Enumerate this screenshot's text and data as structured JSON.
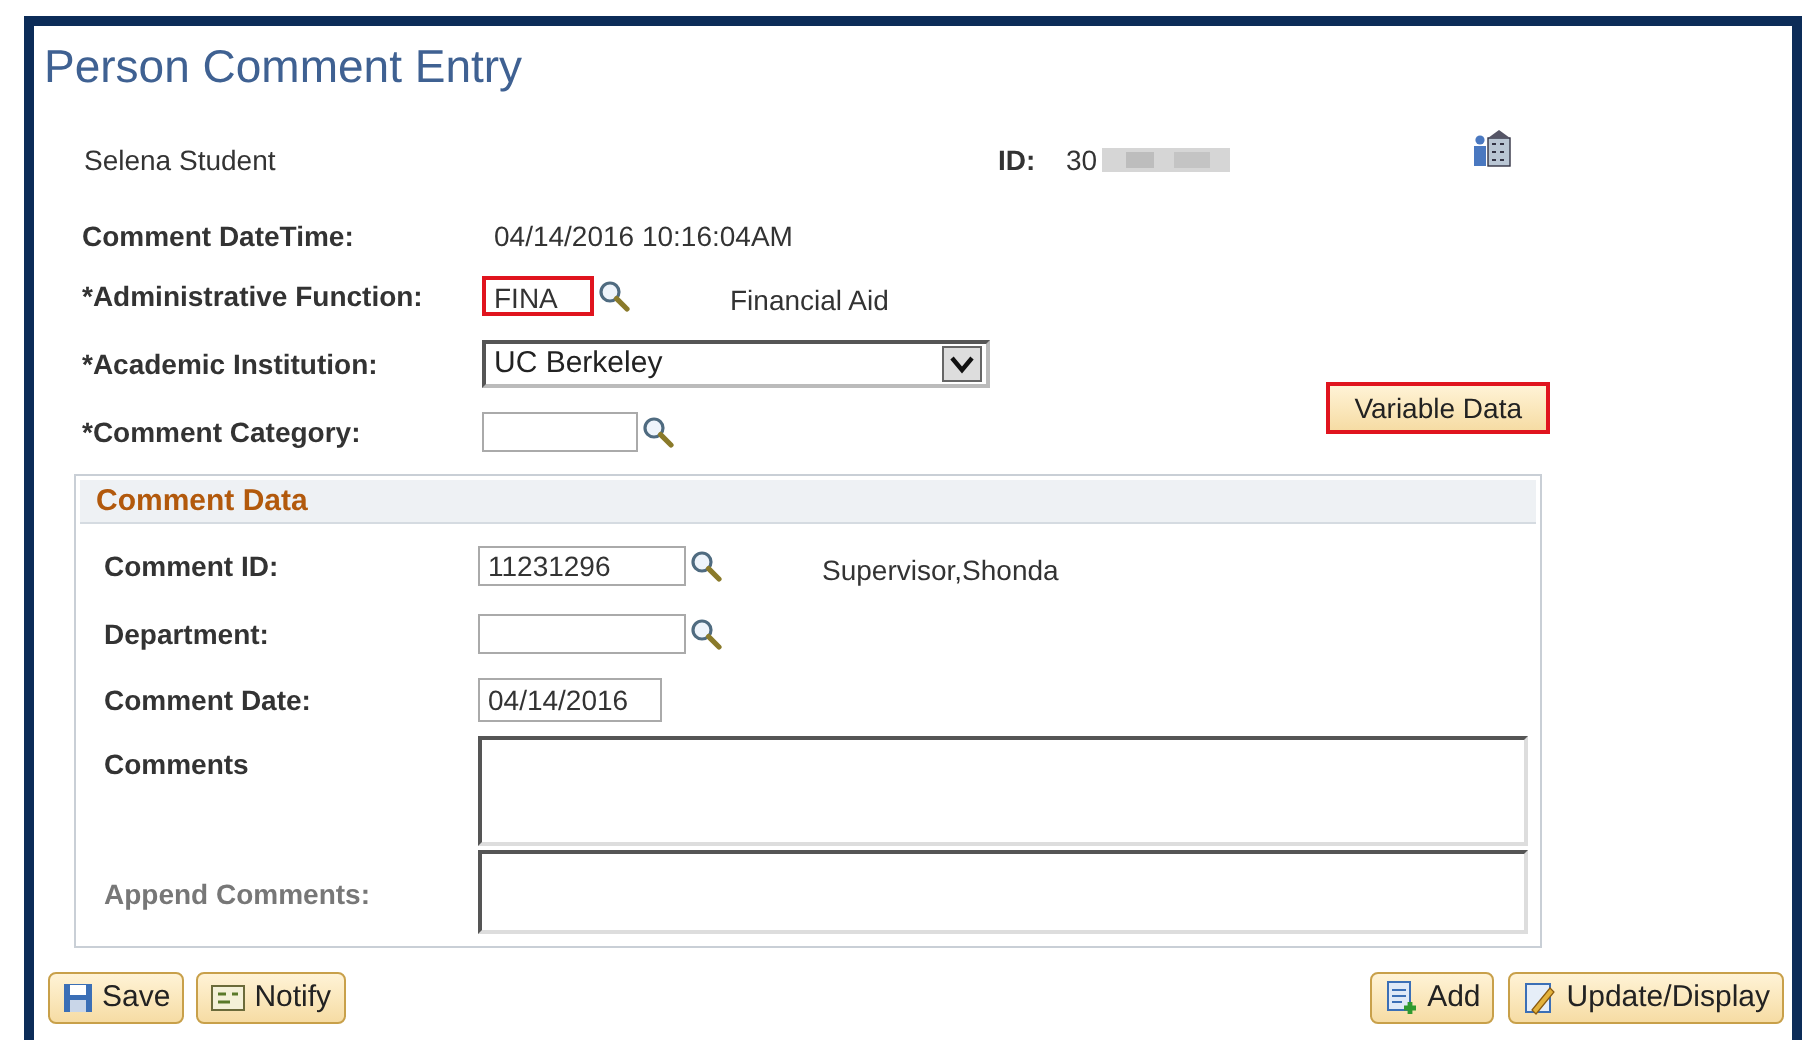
{
  "page_title": "Person Comment Entry",
  "person": {
    "name": "Selena Student",
    "id_label": "ID:",
    "id_value": "30"
  },
  "fields": [
    {
      "kind": "static",
      "label": "Comment DateTime:",
      "value": "04/14/2016 10:16:04AM"
    },
    {
      "kind": "lookup",
      "label": "*Administrative Function:",
      "value": "FINA",
      "description": "Financial Aid",
      "highlighted": true
    },
    {
      "kind": "select",
      "label": "*Academic Institution:",
      "value": "UC Berkeley"
    },
    {
      "kind": "lookup",
      "label": "*Comment Category:",
      "highlighted": false
    }
  ],
  "variable_data_button": {
    "label": "Variable Data",
    "highlighted": true
  },
  "comment_data": {
    "title": "Comment Data",
    "fields": [
      {
        "kind": "lookup",
        "label": "Comment ID:",
        "value": "11231296",
        "description": "Supervisor,Shonda"
      },
      {
        "kind": "lookup",
        "label": "Department:"
      },
      {
        "kind": "date",
        "label": "Comment Date:",
        "value": "04/14/2016"
      },
      {
        "kind": "textarea",
        "label": "Comments",
        "disabled": false
      },
      {
        "kind": "textarea",
        "label": "Append Comments:",
        "disabled": true
      }
    ]
  },
  "buttons_left": [
    {
      "kind": "save",
      "label": "Save"
    },
    {
      "kind": "notify",
      "label": "Notify"
    }
  ],
  "buttons_right": [
    {
      "kind": "add",
      "label": "Add"
    },
    {
      "kind": "update",
      "label": "Update/Display"
    }
  ]
}
